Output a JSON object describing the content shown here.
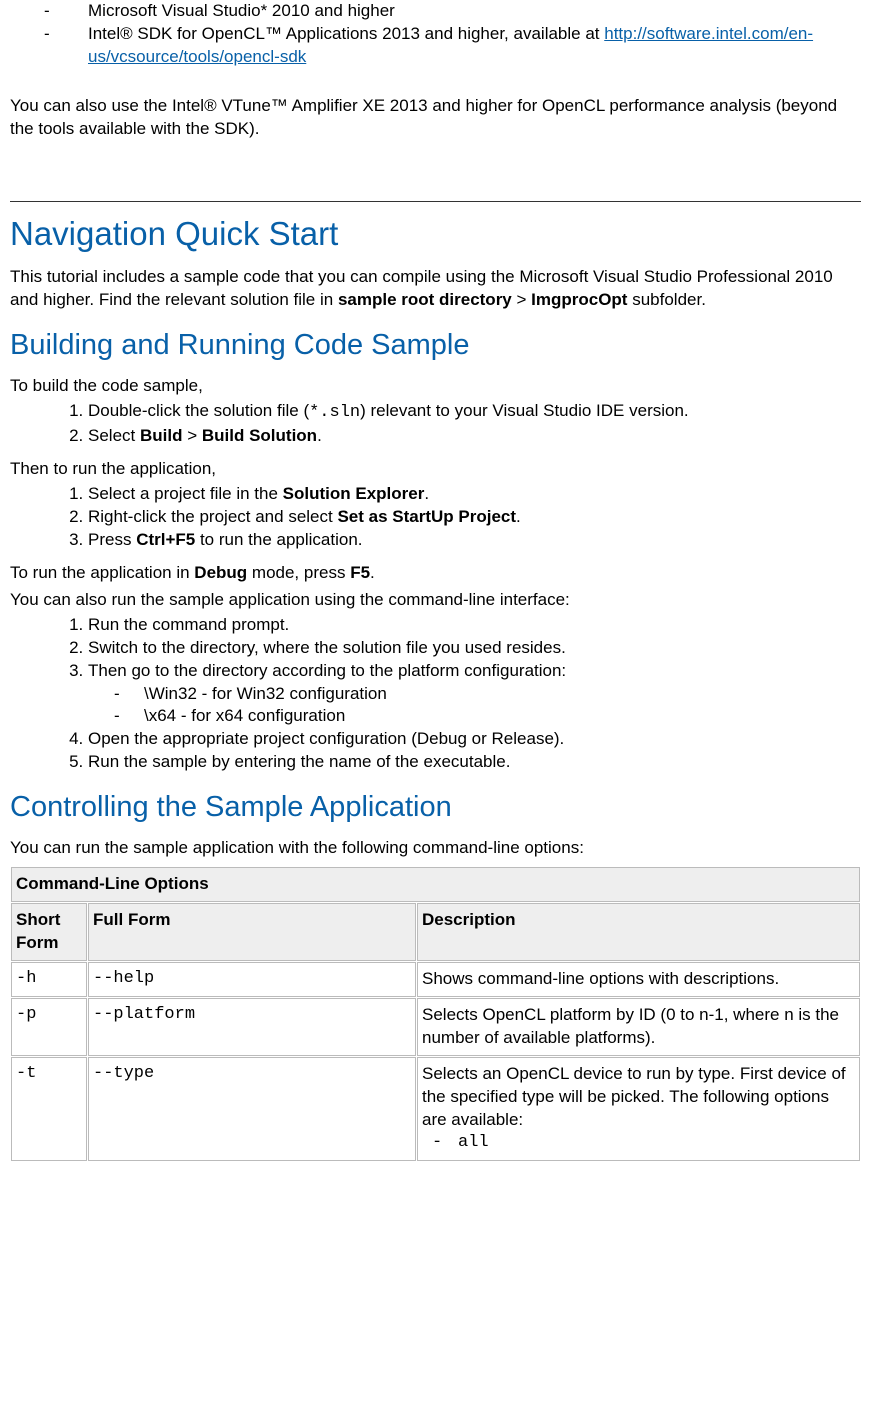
{
  "top_bullets": {
    "item1": "Microsoft Visual Studio* 2010 and higher",
    "item2_prefix": "Intel® SDK for OpenCL™ Applications 2013 and higher, available at ",
    "item2_link": "http://software.intel.com/en-us/vcsource/tools/opencl-sdk"
  },
  "vtune_para": "You can also use the Intel® VTune™ Amplifier XE 2013 and higher for OpenCL performance analysis (beyond the tools available with the SDK).",
  "nav_heading": "Navigation Quick Start",
  "nav_intro_pre": "This tutorial includes a sample code that you can compile using the Microsoft Visual Studio Professional 2010 and higher. Find the relevant solution file in ",
  "nav_intro_b1": "sample root directory",
  "nav_intro_gt": " > ",
  "nav_intro_b2": "ImgprocOpt",
  "nav_intro_suffix": " subfolder.",
  "build_heading": "Building and Running Code Sample",
  "build_intro": "To build the code sample,",
  "build_steps": {
    "s1_a": "Double-click the solution file (",
    "s1_code": "*.sln",
    "s1_b": ") relevant to your Visual Studio IDE version.",
    "s2_a": "Select ",
    "s2_b1": "Build",
    "s2_gt": " > ",
    "s2_b2": "Build Solution",
    "s2_end": "."
  },
  "run_intro": "Then to run the application,",
  "run_steps": {
    "r1_a": "Select a project file in the ",
    "r1_b": "Solution Explorer",
    "r1_end": ".",
    "r2_a": "Right-click the project and select ",
    "r2_b": "Set as StartUp Project",
    "r2_end": ".",
    "r3_a": "Press ",
    "r3_b": "Ctrl+F5",
    "r3_end": " to run the application."
  },
  "debug_line_a": "To run the application in ",
  "debug_line_b1": "Debug",
  "debug_line_mid": " mode, press ",
  "debug_line_b2": "F5",
  "debug_line_end": ".",
  "cli_intro": "You can also run the sample application using the command-line interface:",
  "cli_steps": {
    "c1": "Run the command prompt.",
    "c2": "Switch to the directory, where the solution file you used resides.",
    "c3": "Then go to the directory according to the platform configuration:",
    "c3_sub1": "\\Win32 - for Win32 configuration",
    "c3_sub2": "\\x64 - for x64 configuration",
    "c4": "Open the appropriate project configuration (Debug or Release).",
    "c5": "Run the sample by entering the name of the executable."
  },
  "control_heading": "Controlling the Sample Application",
  "control_intro": "You can run the sample application with the following command-line options:",
  "table": {
    "title": "Command-Line Options",
    "col1": "Short Form",
    "col2": "Full Form",
    "col3": "Description",
    "rows": [
      {
        "short": "-h",
        "full": "--help",
        "desc": "Shows command-line options with descriptions."
      },
      {
        "short": "-p",
        "full": "--platform",
        "desc": "Selects OpenCL platform by ID (0 to n-1, where n is the number of available platforms)."
      },
      {
        "short": "-t",
        "full": "--type",
        "desc": "Selects an OpenCL device to run by type. First device of the specified type will be picked. The following options are available:",
        "sub1": "all"
      }
    ]
  }
}
